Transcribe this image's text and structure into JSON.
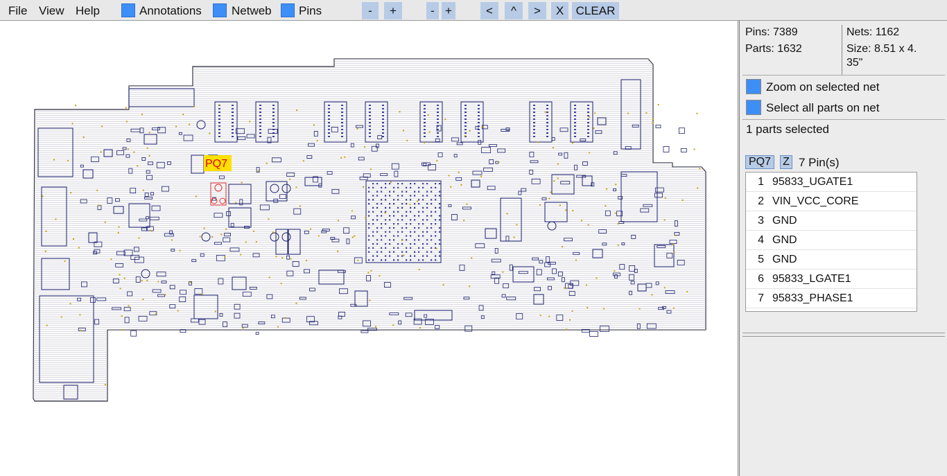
{
  "menu": {
    "file": "File",
    "view": "View",
    "help": "Help"
  },
  "toggles": {
    "annotations": "Annotations",
    "netweb": "Netweb",
    "pins": "Pins"
  },
  "toolbar": {
    "zoom_out_1": "-",
    "zoom_in_1": "+",
    "zoom_out_2": "-",
    "zoom_in_2": "+",
    "prev": "<",
    "up": "^",
    "next": ">",
    "close": "X",
    "clear": "CLEAR"
  },
  "board": {
    "selected_part_label": "PQ7"
  },
  "stats": {
    "pins": "Pins: 7389",
    "parts": "Parts: 1632",
    "nets": "Nets: 1162",
    "size_line1": "Size: 8.51 x 4.",
    "size_line2": "35\""
  },
  "options": {
    "zoom_on_net": "Zoom on selected net",
    "select_all_parts": "Select all parts on net"
  },
  "selection": {
    "summary": "1 parts selected",
    "part": "PQ7",
    "side": "Z",
    "pin_count": "7 Pin(s)"
  },
  "pins": [
    {
      "num": "1",
      "net": "95833_UGATE1"
    },
    {
      "num": "2",
      "net": "VIN_VCC_CORE"
    },
    {
      "num": "3",
      "net": "GND"
    },
    {
      "num": "4",
      "net": "GND"
    },
    {
      "num": "5",
      "net": "GND"
    },
    {
      "num": "6",
      "net": "95833_LGATE1"
    },
    {
      "num": "7",
      "net": "95833_PHASE1"
    }
  ],
  "colors": {
    "accent": "#3e8ef7",
    "button_bg": "#b7cbe6",
    "selection": "#ffe000",
    "selection_text": "#e00000",
    "outline": "#1b1f6e",
    "test_pad": "#c8a000"
  }
}
